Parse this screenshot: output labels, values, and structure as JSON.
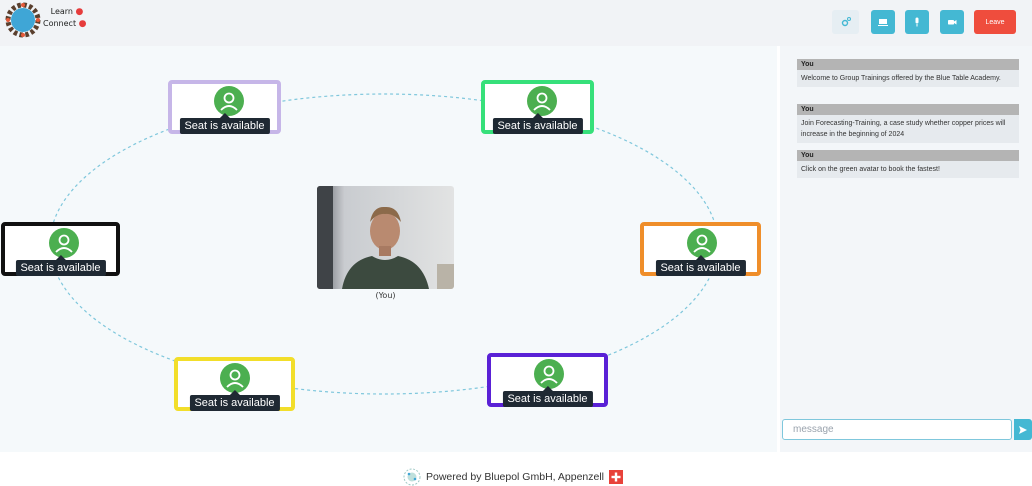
{
  "app": {
    "logo_line1": "Learn",
    "logo_line2": "Connect",
    "accent": "#44b8d3",
    "leave_color": "#ef4d3d"
  },
  "toolbar": {
    "settings_icon": "settings-icon",
    "screen_icon": "screen-share-icon",
    "mic_icon": "microphone-icon",
    "cam_icon": "camera-icon",
    "leave_label": "Leave"
  },
  "seats": [
    {
      "label": "Seat is available",
      "border_color": "#c6b6e8"
    },
    {
      "label": "Seat is available",
      "border_color": "#36e07a"
    },
    {
      "label": "Seat is available",
      "border_color": "#111111"
    },
    {
      "label": "Seat is available",
      "border_color": "#ef8e2a"
    },
    {
      "label": "Seat is available",
      "border_color": "#f2de2a"
    },
    {
      "label": "Seat is available",
      "border_color": "#5a21d6"
    }
  ],
  "avatar_color": "#4caf50",
  "self_video": {
    "label": "(You)"
  },
  "chat": {
    "messages": [
      {
        "author": "You",
        "text": "Welcome to Group Trainings offered by the Blue Table Academy."
      },
      {
        "author": "You",
        "text": "Join Forecasting-Training, a case study whether copper prices will increase in the beginning of 2024"
      },
      {
        "author": "You",
        "text": "Click on the green avatar to book the fastest!"
      }
    ],
    "input_placeholder": "message",
    "input_value": "",
    "send_icon": "send-icon"
  },
  "footer": {
    "text": "Powered by Bluepol GmbH, Appenzell",
    "flag_icon": "swiss-flag-icon"
  }
}
